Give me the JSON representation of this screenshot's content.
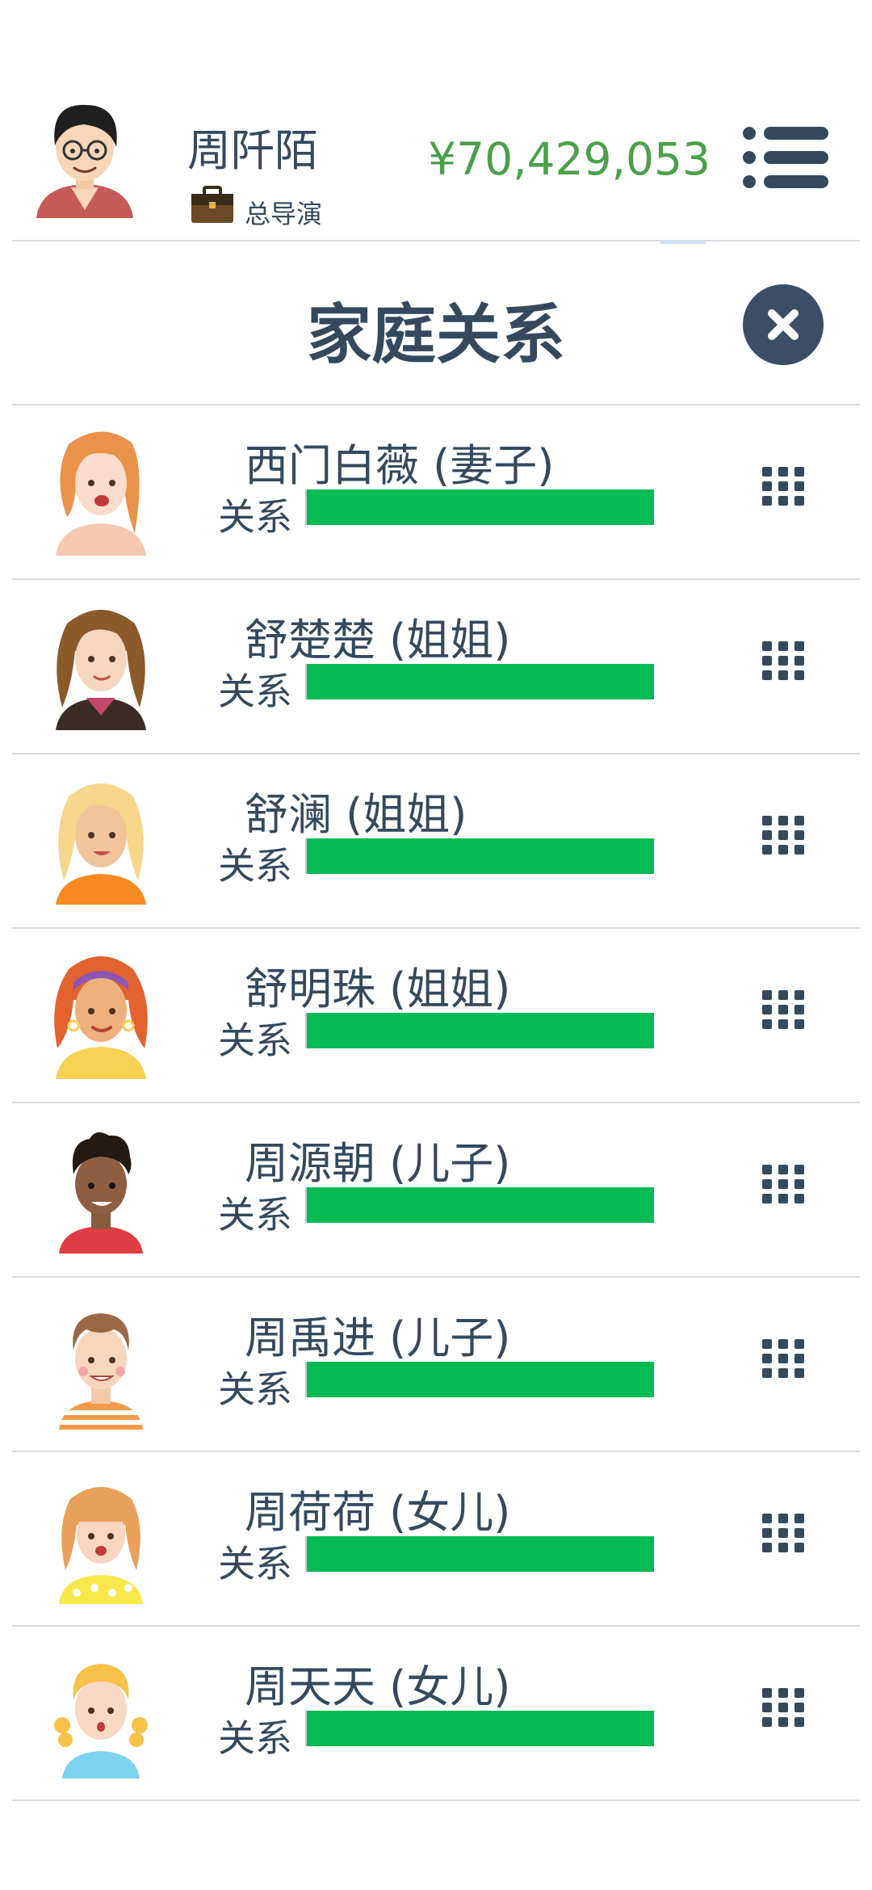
{
  "header": {
    "player_name": "周阡陌",
    "player_role": "总导演",
    "money": "¥70,429,053",
    "avatar_icon": "player-avatar",
    "role_icon": "briefcase-icon",
    "menu_icon": "menu-icon"
  },
  "panel": {
    "title": "家庭关系",
    "close_icon": "close-icon"
  },
  "colors": {
    "text": "#34495e",
    "money": "#4aa04a",
    "relationship_bar": "#06ba54",
    "close_button": "#3a4e66",
    "divider": "#d9dde2"
  },
  "members": [
    {
      "name": "西门白薇 (妻子)",
      "relationship_label": "关系",
      "relationship_level": 1.0,
      "avatar_icon": "woman-orange-hair-avatar"
    },
    {
      "name": "舒楚楚 (姐姐)",
      "relationship_label": "关系",
      "relationship_level": 1.0,
      "avatar_icon": "woman-brown-hair-avatar"
    },
    {
      "name": "舒澜 (姐姐)",
      "relationship_label": "关系",
      "relationship_level": 1.0,
      "avatar_icon": "woman-blonde-hair-avatar"
    },
    {
      "name": "舒明珠 (姐姐)",
      "relationship_label": "关系",
      "relationship_level": 1.0,
      "avatar_icon": "woman-headband-avatar"
    },
    {
      "name": "周源朝 (儿子)",
      "relationship_label": "关系",
      "relationship_level": 1.0,
      "avatar_icon": "boy-curly-hair-avatar"
    },
    {
      "name": "周禹进 (儿子)",
      "relationship_label": "关系",
      "relationship_level": 1.0,
      "avatar_icon": "boy-striped-shirt-avatar"
    },
    {
      "name": "周荷荷 (女儿)",
      "relationship_label": "关系",
      "relationship_level": 1.0,
      "avatar_icon": "girl-polka-dot-avatar"
    },
    {
      "name": "周天天 (女儿)",
      "relationship_label": "关系",
      "relationship_level": 1.0,
      "avatar_icon": "girl-pigtails-avatar"
    }
  ]
}
